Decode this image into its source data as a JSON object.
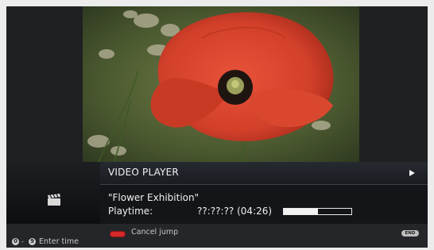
{
  "player": {
    "title": "VIDEO PLAYER",
    "clip_name": "\"Flower Exhibition\"",
    "playtime_label": "Playtime:",
    "playtime_value": "??:??:?? (04:26)",
    "progress_fraction": 0.5
  },
  "helpbar": {
    "cancel_label": "Cancel jump",
    "enter_label": "Enter time",
    "num_from": "0",
    "num_to": "9",
    "end_key": "END",
    "red_key_color": "#d42a2a"
  },
  "icons": {
    "play": "play-icon",
    "clapperboard": "clapperboard-icon"
  }
}
